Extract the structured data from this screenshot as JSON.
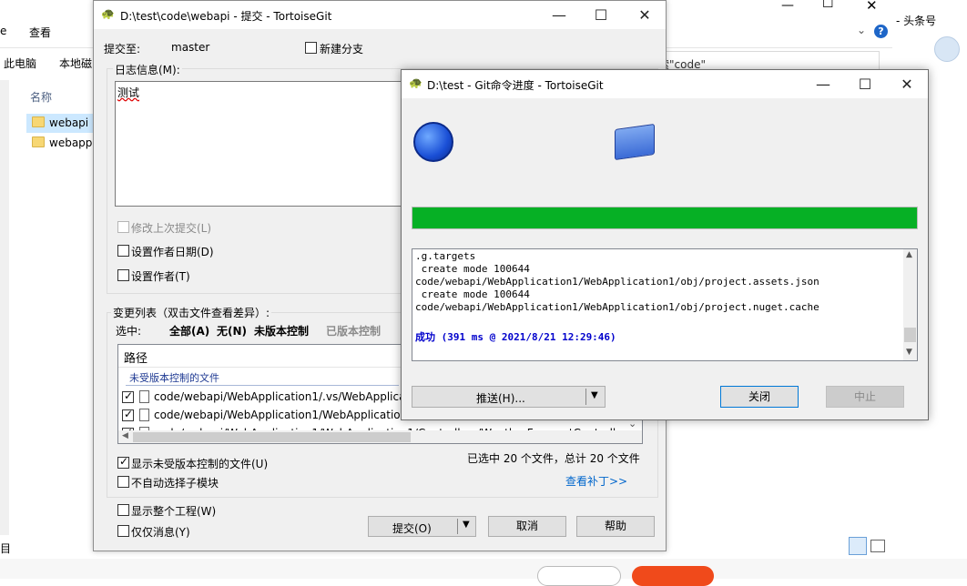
{
  "explorer": {
    "menu_view": "查看",
    "breadcrumb_pc": "此电脑",
    "breadcrumb_disk": "本地磁",
    "search_text": "索\"code\"",
    "column_name": "名称",
    "folders": [
      "webapi",
      "webapp"
    ],
    "right_label": "- 头条号",
    "left_cut_label": "目"
  },
  "commit": {
    "title": "D:\\test\\code\\webapi - 提交 - TortoiseGit",
    "commit_to_label": "提交至:",
    "branch": "master",
    "new_branch": "新建分支",
    "log_label": "日志信息(M):",
    "message": "测试",
    "amend": "修改上次提交(L)",
    "set_author_date": "设置作者日期(D)",
    "set_author": "设置作者(T)",
    "changes_label": "变更列表（双击文件查看差异）:",
    "select_label": "选中:",
    "sel_all": "全部(A)",
    "sel_none": "无(N)",
    "sel_unversioned": "未版本控制",
    "sel_versioned": "已版本控制",
    "list_header": "路径",
    "group_unversioned": "未受版本控制的文件",
    "files": [
      "code/webapi/WebApplication1/.vs/WebApplication",
      "code/webapi/WebApplication1/WebApplication1.sl",
      "code/webapi/WebApplication1/WebApplication1/Controllers/WeatherForecastControlle"
    ],
    "selected_summary": "已选中 20 个文件，总计 20 个文件",
    "show_unversioned": "显示未受版本控制的文件(U)",
    "no_auto_submodule": "不自动选择子模块",
    "view_patch": "查看补丁>>",
    "show_whole_project": "显示整个工程(W)",
    "message_only": "仅仅消息(Y)",
    "btn_commit": "提交(O)",
    "btn_cancel": "取消",
    "btn_help": "帮助"
  },
  "progress": {
    "title": "D:\\test - Git命令进度 - TortoiseGit",
    "percent": 100,
    "log": [
      ".g.targets",
      " create mode 100644",
      "code/webapi/WebApplication1/WebApplication1/obj/project.assets.json",
      " create mode 100644",
      "code/webapi/WebApplication1/WebApplication1/obj/project.nuget.cache"
    ],
    "success": "成功 (391 ms @ 2021/8/21 12:29:46)",
    "btn_push": "推送(H)...",
    "btn_close": "关闭",
    "btn_abort": "中止"
  },
  "colors": {
    "progress_fill": "#06b025",
    "success_text": "#0000cc",
    "link": "#0066cc"
  }
}
